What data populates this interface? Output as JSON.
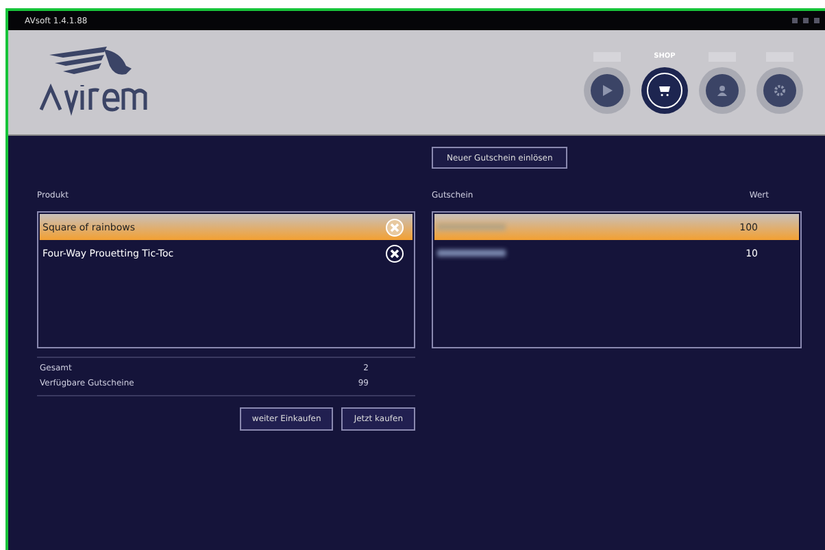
{
  "window": {
    "title": "AVsoft 1.4.1.88"
  },
  "nav": [
    {
      "kind": "play",
      "selected": false
    },
    {
      "kind": "cart",
      "label": "SHOP",
      "selected": true
    },
    {
      "kind": "user",
      "selected": false
    },
    {
      "kind": "gear",
      "selected": false
    }
  ],
  "redeem_button": "Neuer Gutschein einlösen",
  "products": {
    "header": "Produkt",
    "rows": [
      {
        "name": "Square of rainbows",
        "selected": true
      },
      {
        "name": "Four-Way Prouetting Tic-Toc",
        "selected": false
      }
    ]
  },
  "vouchers": {
    "columns": [
      "Gutschein",
      "Wert"
    ],
    "rows": [
      {
        "value": "100",
        "selected": true
      },
      {
        "value": "10",
        "selected": false
      }
    ]
  },
  "summary": [
    {
      "label": "Gesamt",
      "value": "2"
    },
    {
      "label": "Verfügbare Gutscheine",
      "value": "99"
    }
  ],
  "buttons": [
    "weiter Einkaufen",
    "Jetzt kaufen"
  ]
}
